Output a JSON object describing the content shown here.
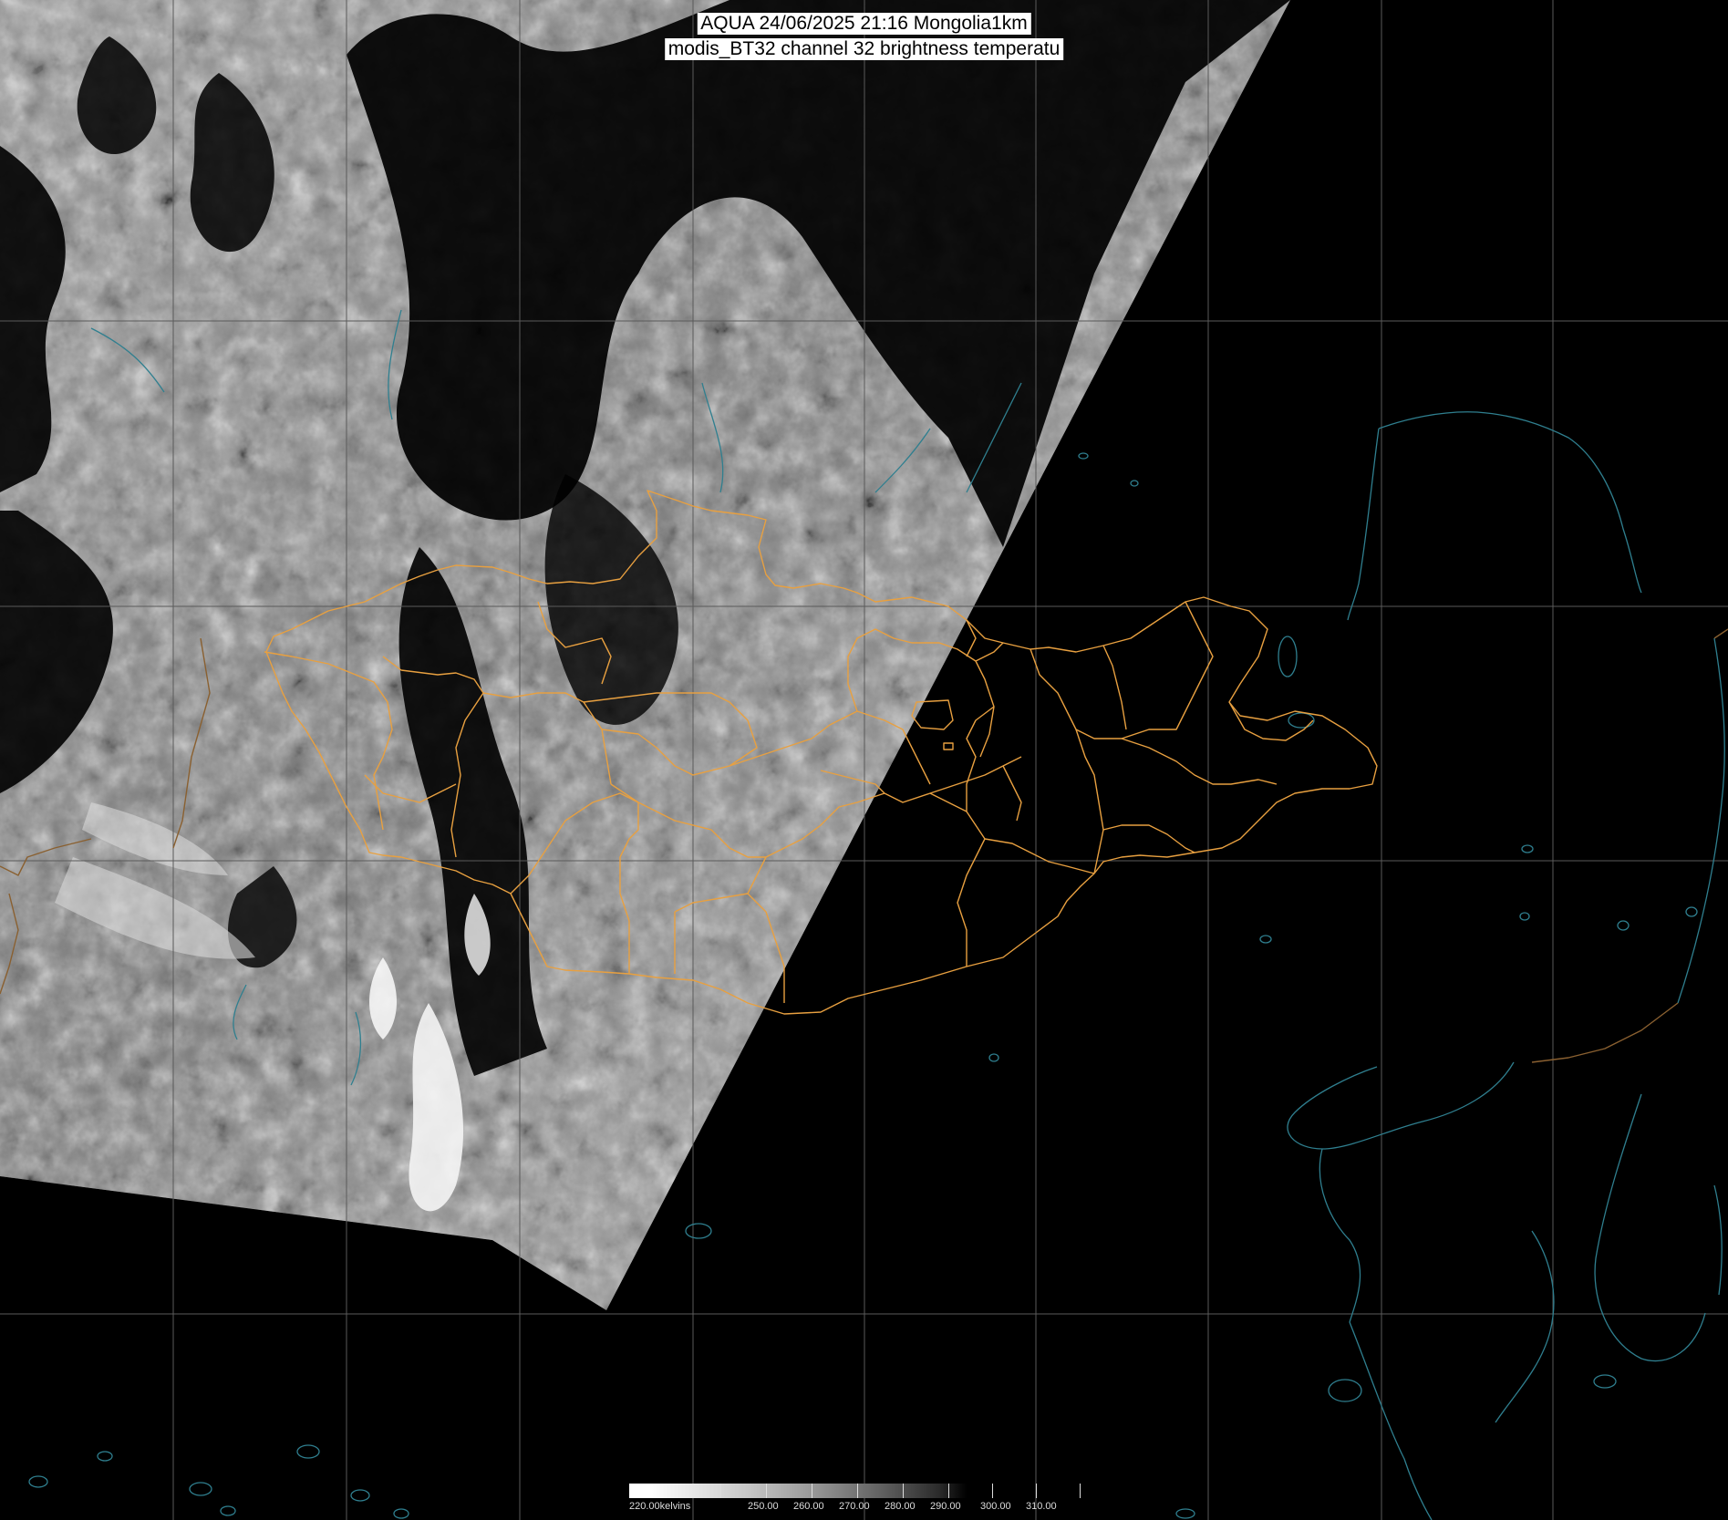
{
  "title": {
    "line1": "AQUA 24/06/2025 21:16 Mongolia1km",
    "line2": "modis_BT32 channel 32 brightness temperatu"
  },
  "colorbar": {
    "labels": [
      "220.00kelvins",
      "250.00",
      "260.00",
      "270.00",
      "280.00",
      "290.00",
      "300.00",
      "310.00"
    ]
  },
  "colors": {
    "background": "#000000",
    "grid": "#5a5a5a",
    "admin_borders": "#e8a040",
    "coastlines": "#2f7f8f"
  }
}
